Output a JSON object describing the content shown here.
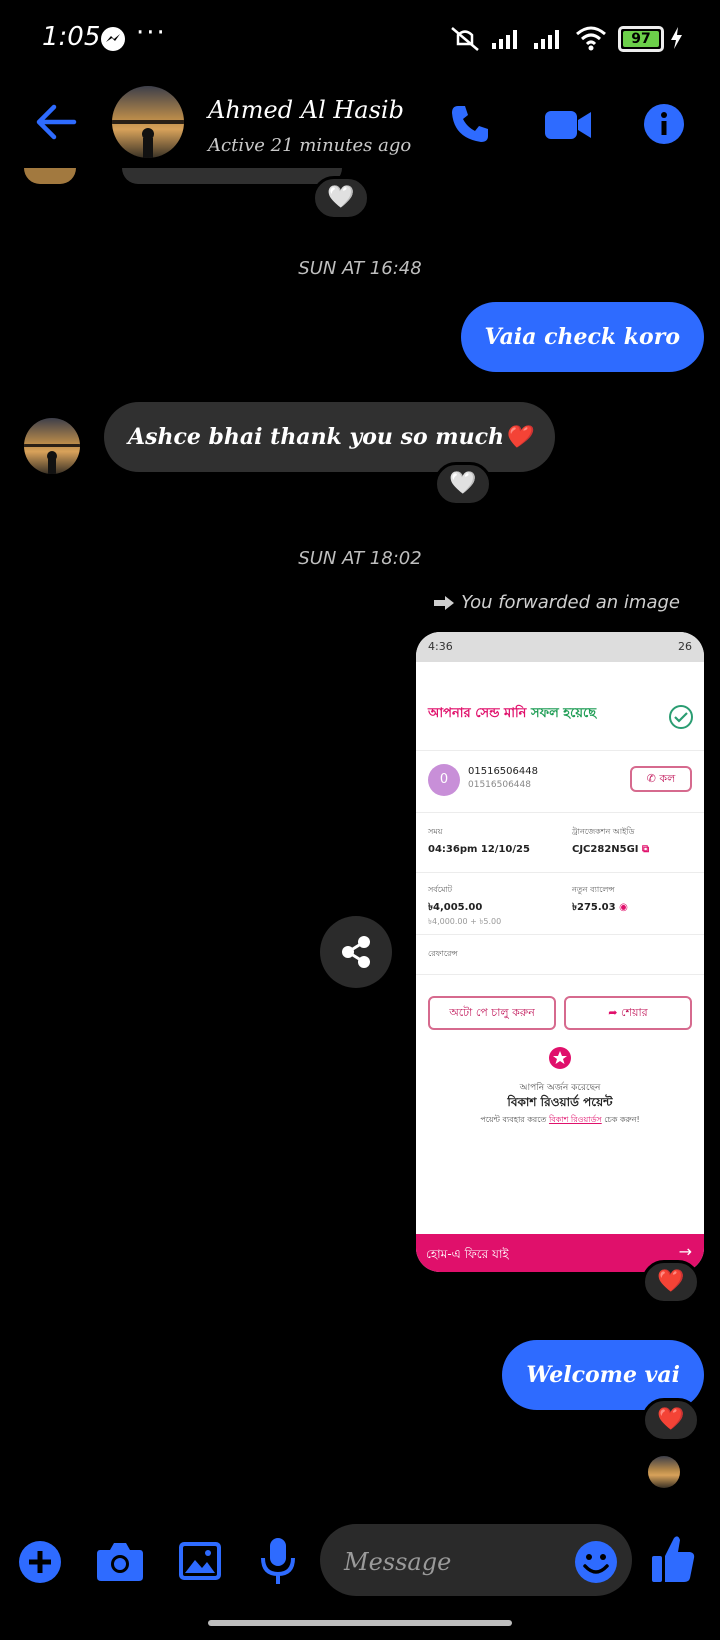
{
  "status_bar": {
    "time": "1:05",
    "overflow": "···",
    "battery": "97",
    "icons": [
      "messenger-icon",
      "mute-icon",
      "signal-icon",
      "signal-icon",
      "wifi-icon",
      "battery-icon",
      "charging-icon"
    ]
  },
  "header": {
    "name": "Ahmed Al Hasib",
    "status": "Active 21 minutes ago",
    "accent_color": "#2e6bff"
  },
  "messages": {
    "ts1": "SUN AT 16:48",
    "sent1": "Vaia check koro",
    "recv1": "Ashce bhai thank you so much❤️",
    "ts2": "SUN AT 18:02",
    "forward_note": "You forwarded an image",
    "sent2": "Welcome vai"
  },
  "reactions": {
    "top": "🤍",
    "recv1": "🤍",
    "image": "❤️",
    "sent2": "❤️"
  },
  "forwarded_image": {
    "status_time": "4:36",
    "status_right": "26",
    "title_part1": "আপনার",
    "title_part2": "সেন্ড মানি",
    "title_part3": "সফল হয়েছে",
    "recipient_initial": "0",
    "recipient_number": "01516506448",
    "recipient_sub": "01516506448",
    "call_label": "কল",
    "time_label": "সময়",
    "time_value": "04:36pm 12/10/25",
    "txn_label": "ট্রানজেকশন আইডি",
    "txn_value": "CJC282N5GI",
    "total_label": "সর্বমোট",
    "total_value": "৳4,005.00",
    "total_sub": "৳4,000.00 + ৳5.00",
    "balance_label": "নতুন ব্যালেন্স",
    "balance_value": "৳275.03",
    "reference_label": "রেফারেন্স",
    "autopay_btn": "অটো পে চালু করুন",
    "share_btn": "শেয়ার",
    "reward_line1": "আপনি অর্জন করেছেন",
    "reward_line2": "বিকাশ রিওয়ার্ড পয়েন্ট",
    "reward_line3_a": "পয়েন্ট ব্যবহার করতে",
    "reward_line3_link": "বিকাশ রিওয়ার্ডস",
    "reward_line3_b": "চেক করুন!",
    "footer": "হোম-এ ফিরে যাই",
    "footer_arrow": "→",
    "brand_pink": "#e0106b"
  },
  "composer": {
    "placeholder": "Message"
  }
}
